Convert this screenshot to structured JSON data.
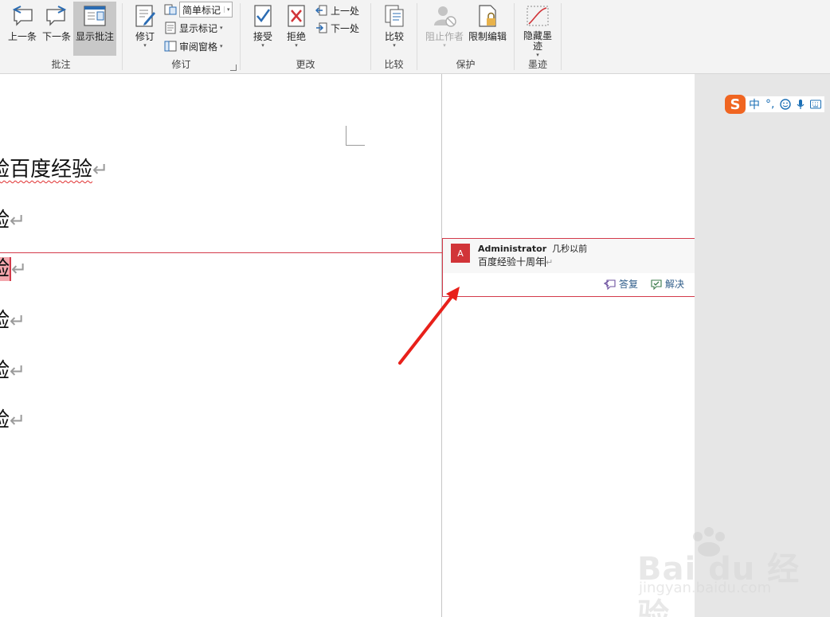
{
  "ribbon": {
    "groups": {
      "comments": {
        "label": "批注",
        "prev": "上一条",
        "next": "下一条",
        "show": "显示批注"
      },
      "tracking": {
        "label": "修订",
        "track_changes": "修订",
        "markup_combo": "简单标记",
        "show_markup": "显示标记",
        "reviewing_pane": "审阅窗格"
      },
      "changes": {
        "label": "更改",
        "accept": "接受",
        "reject": "拒绝",
        "previous": "上一处",
        "next": "下一处"
      },
      "compare": {
        "label": "比较",
        "compare": "比较"
      },
      "protect": {
        "label": "保护",
        "block_authors": "阻止作者",
        "restrict_editing": "限制编辑"
      },
      "ink": {
        "label": "墨迹",
        "hide_ink_line1": "隐藏墨",
        "hide_ink_line2": "迹"
      }
    }
  },
  "document": {
    "paragraphs": [
      {
        "text": "验百度经验",
        "mark": "↵"
      },
      {
        "text": "验",
        "mark": "↵"
      },
      {
        "text": "验",
        "mark": "↵"
      },
      {
        "text": "验",
        "mark": "↵"
      },
      {
        "text": "验",
        "mark": "↵"
      },
      {
        "text": "验",
        "mark": "↵"
      }
    ]
  },
  "comment": {
    "avatar_initial": "A",
    "author": "Administrator",
    "time": "几秒以前",
    "text": "百度经验十周年",
    "reply": "答复",
    "resolve": "解决"
  },
  "ime": {
    "logo": "S",
    "lang": "中",
    "punct": "°,"
  },
  "watermark": {
    "brand": "Bai du 经验",
    "url": "jingyan.baidu.com"
  },
  "colors": {
    "accent_red": "#d33a4a",
    "highlight": "#f3a7ad",
    "ribbon_bg": "#f3f3f3",
    "ime_orange": "#f06521"
  }
}
